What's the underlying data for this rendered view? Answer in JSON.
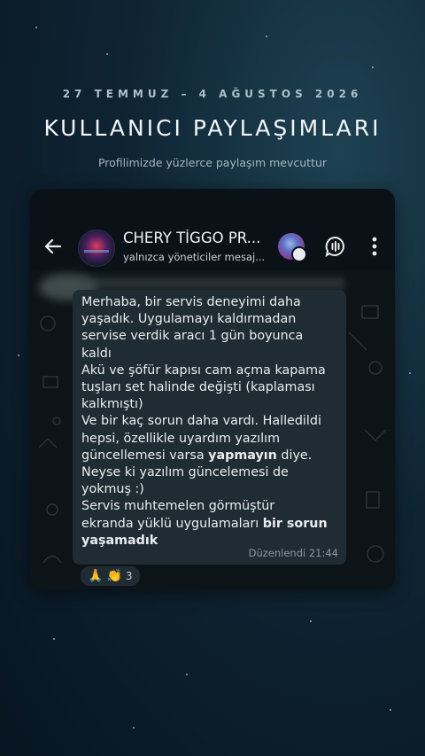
{
  "promo": {
    "date_range": "27 TEMMUZ – 4 AĞUSTOS 2026",
    "title": "KULLANICI PAYLAŞIMLARI",
    "subtitle": "Profilimizde yüzlerce paylaşım mevcuttur"
  },
  "chat_header": {
    "channel_name": "CHERY TİGGO PR...",
    "channel_subtitle": "yalnızca yöneticiler mesaj..."
  },
  "message": {
    "lines": [
      "Merhaba, bir servis deneyimi daha",
      "yaşadık. Uygulamayı kaldırmadan",
      "servise verdik aracı 1 gün boyunca",
      "kaldı",
      "Akü ve şöfür kapısı cam açma kapama",
      "tuşları set halinde değişti (kaplaması",
      "kalkmıştı)",
      "Ve bir kaç sorun daha vardı. Halledildi",
      "hepsi, özellikle uyardım yazılım",
      "güncellemesi varsa ",
      "yapmayın",
      " diye.",
      "Neyse ki yazılım güncelemesi de",
      "yokmuş :)",
      "Servis muhtemelen görmüştür",
      "ekranda yüklü uygulamaları ",
      "bir sorun",
      "yaşamadık"
    ],
    "edited_label": "Düzenlendi 21:44"
  },
  "reactions": {
    "emoji_1": "🙏",
    "emoji_2": "👏",
    "count": "3"
  },
  "icons": {
    "back": "arrow-left-icon",
    "chat": "chat-bubble-icon",
    "more": "more-vertical-icon"
  },
  "colors": {
    "background": "#0f2433",
    "bubble": "#202c33",
    "chat_area": "#0d1418"
  }
}
